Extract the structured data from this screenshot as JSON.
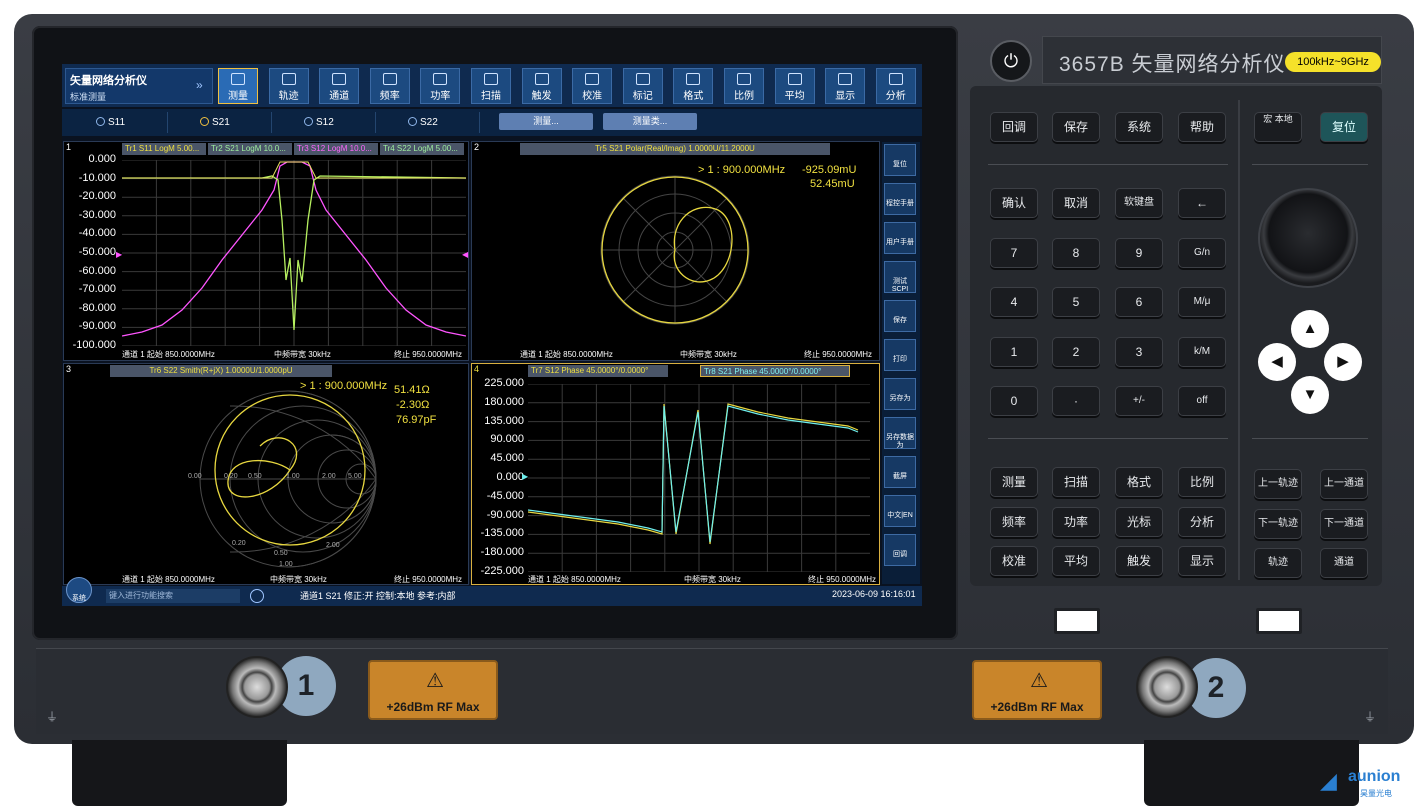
{
  "device": {
    "header_model": "3657B 矢量网络分析仪",
    "range_badge": "100kHz~9GHz",
    "power_icon": "⏻"
  },
  "screen": {
    "app_title": "矢量网络分析仪",
    "app_subtitle": "标准测量",
    "toolbar": [
      "测量",
      "轨迹",
      "通道",
      "频率",
      "功率",
      "扫描",
      "触发",
      "校准",
      "标记",
      "格式",
      "比例",
      "平均",
      "显示",
      "分析"
    ],
    "active_tool": "测量",
    "ports": [
      "S11",
      "S21",
      "S12",
      "S22"
    ],
    "selected_port": "S21",
    "port_buttons": [
      "测量...",
      "测量类..."
    ],
    "softkeys": [
      "复位",
      "程控手册",
      "用户手册",
      "测试SCPI",
      "保存",
      "打印",
      "另存为",
      "另存数据为",
      "截屏",
      "中文|EN",
      "回调"
    ],
    "search_placeholder": "键入进行功能搜索",
    "system_btn": "系统",
    "status_text": "通道1 S21 修正:开 控制:本地 参考:内部",
    "datetime": "2023-06-09 16:16:01",
    "panes": {
      "p1": {
        "num": "1",
        "traces": [
          "Tr1 S11 LogM 5.00...",
          "Tr2 S21 LogM 10.0...",
          "Tr3 S12 LogM 10.0...",
          "Tr4 S22 LogM 5.00..."
        ],
        "yticks": [
          "0.000",
          "-10.000",
          "-20.000",
          "-30.000",
          "-40.000",
          "-50.000",
          "-60.000",
          "-70.000",
          "-80.000",
          "-90.000",
          "-100.000"
        ],
        "start": "通道 1 起始 850.0000MHz",
        "ifbw": "中频带宽 30kHz",
        "stop": "终止 950.0000MHz"
      },
      "p2": {
        "num": "2",
        "trace": "Tr5 S21 Polar(Real/Imag) 1.0000U/11.2000U",
        "marker": "> 1  : 900.000MHz",
        "m_val1": "-925.09mU",
        "m_val2": "52.45mU",
        "start": "通道 1 起始 850.0000MHz",
        "ifbw": "中频带宽 30kHz",
        "stop": "终止 950.0000MHz"
      },
      "p3": {
        "num": "3",
        "trace": "Tr6 S22 Smith(R+jX) 1.0000U/1.0000pU",
        "marker": "> 1  : 900.000MHz",
        "m_val1": "51.41Ω",
        "m_val2": "-2.30Ω",
        "m_val3": "76.97pF",
        "smith_labels": [
          "0.00",
          "0.20",
          "0.50",
          "1.00",
          "2.00",
          "5.00",
          "0.20",
          "0.50",
          "2.00",
          "1.00"
        ],
        "start": "通道 1 起始 850.0000MHz",
        "ifbw": "中频带宽 30kHz",
        "stop": "终止 950.0000MHz"
      },
      "p4": {
        "num": "4",
        "traces": [
          "Tr7 S12 Phase 45.0000°/0.0000°",
          "Tr8 S21 Phase 45.0000°/0.0000°"
        ],
        "yticks": [
          "225.000",
          "180.000",
          "135.000",
          "90.000",
          "45.000",
          "0.000",
          "-45.000",
          "-90.000",
          "-135.000",
          "-180.000",
          "-225.000"
        ],
        "start": "通道 1 起始 850.0000MHz",
        "ifbw": "中频带宽 30kHz",
        "stop": "终止 950.0000MHz"
      }
    }
  },
  "keys": {
    "row1": [
      "回调",
      "保存",
      "系统",
      "帮助"
    ],
    "macro": "宏 本地",
    "reset": "复位",
    "entry": [
      [
        "确认",
        "取消",
        "软键盘",
        "←"
      ],
      [
        "7",
        "8",
        "9",
        "G/n"
      ],
      [
        "4",
        "5",
        "6",
        "M/μ"
      ],
      [
        "1",
        "2",
        "3",
        "k/M"
      ],
      [
        "0",
        "·",
        "+/-",
        "off"
      ]
    ],
    "func": [
      [
        "测量",
        "扫描",
        "格式",
        "比例"
      ],
      [
        "频率",
        "功率",
        "光标",
        "分析"
      ],
      [
        "校准",
        "平均",
        "触发",
        "显示"
      ]
    ],
    "nav": [
      [
        "上一轨迹",
        "上一通道"
      ],
      [
        "下一轨迹",
        "下一通道"
      ],
      [
        "轨迹",
        "通道"
      ]
    ],
    "arrows": [
      "▲",
      "◀",
      "▶",
      "▼"
    ]
  },
  "front": {
    "port1": "1",
    "port2": "2",
    "warning": "+26dBm RF  Max",
    "warn_icon": "⚠"
  },
  "logo": {
    "name": "aunion",
    "sub": "昊量光电"
  }
}
